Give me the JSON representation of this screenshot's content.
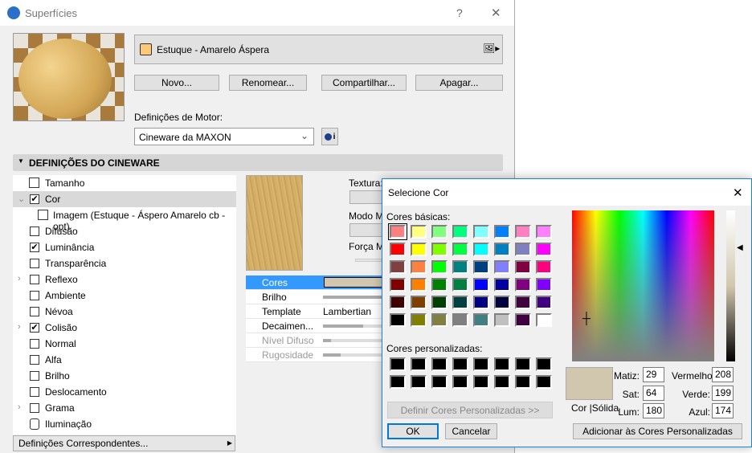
{
  "main": {
    "title": "Superfícies",
    "help": "?",
    "close": "✕",
    "surface_name": "Estuque - Amarelo Áspera",
    "surface_color": "#fcc97a",
    "buttons": {
      "new": "Novo...",
      "rename": "Renomear...",
      "share": "Compartilhar...",
      "delete": "Apagar..."
    },
    "engine_label": "Definições de Motor:",
    "engine_value": "Cineware da MAXON",
    "engine_info": "i",
    "section_title": "DEFINIÇÕES DO CINEWARE",
    "tree": [
      {
        "label": "Tamanho",
        "type": "icon"
      },
      {
        "label": "Cor",
        "checked": true,
        "expanded": true,
        "selected": true
      },
      {
        "label": "Imagem (Estuque - Áspero Amarelo cb -opt)",
        "type": "image"
      },
      {
        "label": "Difusão",
        "checked": false
      },
      {
        "label": "Luminância",
        "checked": true
      },
      {
        "label": "Transparência",
        "checked": false
      },
      {
        "label": "Reflexo",
        "checked": false,
        "expandable": true
      },
      {
        "label": "Ambiente",
        "checked": false
      },
      {
        "label": "Névoa",
        "checked": false
      },
      {
        "label": "Colisão",
        "checked": true,
        "expandable": true
      },
      {
        "label": "Normal",
        "checked": false
      },
      {
        "label": "Alfa",
        "checked": false
      },
      {
        "label": "Brilho",
        "checked": false
      },
      {
        "label": "Deslocamento",
        "checked": false
      },
      {
        "label": "Grama",
        "checked": false,
        "expandable": true
      },
      {
        "label": "Iluminação",
        "type": "light"
      }
    ],
    "matching_settings": "Definições Correspondentes...",
    "texture_label": "Textura:",
    "mode_label": "Modo M",
    "force_label": "Força M",
    "properties": [
      {
        "key": "Cores",
        "selected": true
      },
      {
        "key": "Brilho",
        "bar": 1.0
      },
      {
        "key": "Template",
        "value": "Lambertian"
      },
      {
        "key": "Decaimen...",
        "bar": 0.62
      },
      {
        "key": "Nível Difuso",
        "bar": 0.12,
        "disabled": true
      },
      {
        "key": "Rugosidade",
        "bar": 0.28,
        "disabled": true
      }
    ]
  },
  "dialog": {
    "title": "Selecione Cor",
    "close": "✕",
    "basic_label": "Cores básicas:",
    "basic_colors": [
      "#FF8080",
      "#FFFF80",
      "#80FF80",
      "#00FF80",
      "#80FFFF",
      "#0080FF",
      "#FF80C0",
      "#FF80FF",
      "#FF0000",
      "#FFFF00",
      "#80FF00",
      "#00FF40",
      "#00FFFF",
      "#0080C0",
      "#8080C0",
      "#FF00FF",
      "#804040",
      "#FF8040",
      "#00FF00",
      "#008080",
      "#004080",
      "#8080FF",
      "#800040",
      "#FF0080",
      "#800000",
      "#FF8000",
      "#008000",
      "#008040",
      "#0000FF",
      "#0000A0",
      "#800080",
      "#8000FF",
      "#400000",
      "#804000",
      "#004000",
      "#004040",
      "#000080",
      "#000040",
      "#400040",
      "#400080",
      "#000000",
      "#808000",
      "#808040",
      "#808080",
      "#408080",
      "#C0C0C0",
      "#400040",
      "#FFFFFF"
    ],
    "custom_label": "Cores personalizadas:",
    "define_custom": "Definir Cores Personalizadas >>",
    "ok": "OK",
    "cancel": "Cancelar",
    "color_solid_label": "Cor |Sólida",
    "current_color": "#d0c7ae",
    "hue_label": "Matiz:",
    "hue": "29",
    "sat_label": "Sat:",
    "sat": "64",
    "lum_label": "Lum:",
    "lum": "180",
    "red_label": "Vermelho:",
    "red": "208",
    "green_label": "Verde:",
    "green": "199",
    "blue_label": "Azul:",
    "blue": "174",
    "add_custom": "Adicionar às Cores Personalizadas"
  }
}
